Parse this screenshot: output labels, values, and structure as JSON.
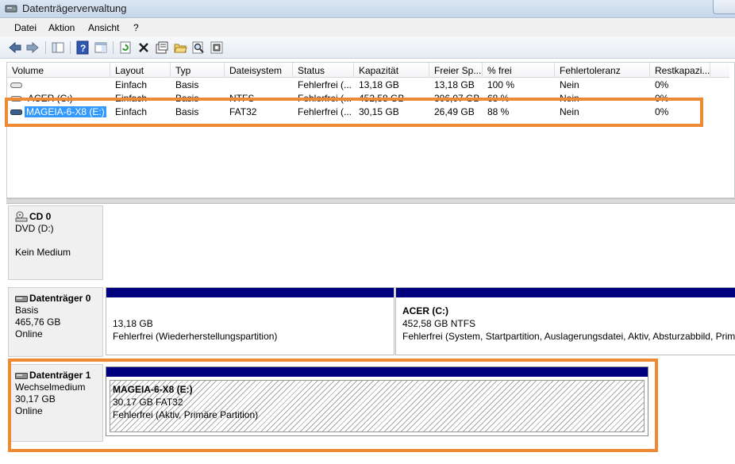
{
  "window": {
    "title": "Datenträgerverwaltung"
  },
  "menu": {
    "items": [
      "Datei",
      "Aktion",
      "Ansicht",
      "?"
    ]
  },
  "toolbar": {
    "icons": [
      "back-arrow-icon",
      "forward-arrow-icon",
      "console-tree-icon",
      "help-icon",
      "show-pane-icon",
      "refresh-icon",
      "delete-icon",
      "properties-icon",
      "open-folder-icon",
      "search-icon",
      "settings-icon"
    ]
  },
  "volume_list": {
    "columns": [
      "Volume",
      "Layout",
      "Typ",
      "Dateisystem",
      "Status",
      "Kapazität",
      "Freier Sp...",
      "% frei",
      "Fehlertoleranz",
      "Restkapazi..."
    ],
    "rows": [
      {
        "volume": "",
        "layout": "Einfach",
        "typ": "Basis",
        "dateisystem": "",
        "status": "Fehlerfrei (...",
        "kapazitaet": "13,18 GB",
        "frei": "13,18 GB",
        "prozent": "100 %",
        "fehlertoleranz": "Nein",
        "rest": "0%"
      },
      {
        "volume": "ACER (C:)",
        "layout": "Einfach",
        "typ": "Basis",
        "dateisystem": "NTFS",
        "status": "Fehlerfrei (...",
        "kapazitaet": "452,58 GB",
        "frei": "306,07 GB",
        "prozent": "68 %",
        "fehlertoleranz": "Nein",
        "rest": "0%"
      },
      {
        "volume": "MAGEIA-6-X8 (E:)",
        "layout": "Einfach",
        "typ": "Basis",
        "dateisystem": "FAT32",
        "status": "Fehlerfrei (...",
        "kapazitaet": "30,15 GB",
        "frei": "26,49 GB",
        "prozent": "88 %",
        "fehlertoleranz": "Nein",
        "rest": "0%"
      }
    ]
  },
  "disks": [
    {
      "name": "CD 0",
      "line2": "DVD (D:)",
      "line3": "",
      "line4": "Kein Medium"
    },
    {
      "name": "Datenträger 0",
      "line2": "Basis",
      "line3": "465,76 GB",
      "line4": "Online"
    },
    {
      "name": "Datenträger 1",
      "line2": "Wechselmedium",
      "line3": "30,17 GB",
      "line4": "Online"
    }
  ],
  "partitions": {
    "recovery": {
      "size": "13,18 GB",
      "status": "Fehlerfrei (Wiederherstellungspartition)"
    },
    "acer": {
      "name": "ACER  (C:)",
      "size": "452,58 GB NTFS",
      "status": "Fehlerfrei (System, Startpartition, Auslagerungsdatei, Aktiv, Absturzabbild, Primä"
    },
    "mageia": {
      "name": "MAGEIA-6-X8  (E:)",
      "size": "30,17 GB FAT32",
      "status": "Fehlerfrei (Aktiv, Primäre Partition)"
    }
  },
  "colors": {
    "partition_bar": "#00007f",
    "highlight": "#ef8a34",
    "selection": "#3399ff"
  }
}
